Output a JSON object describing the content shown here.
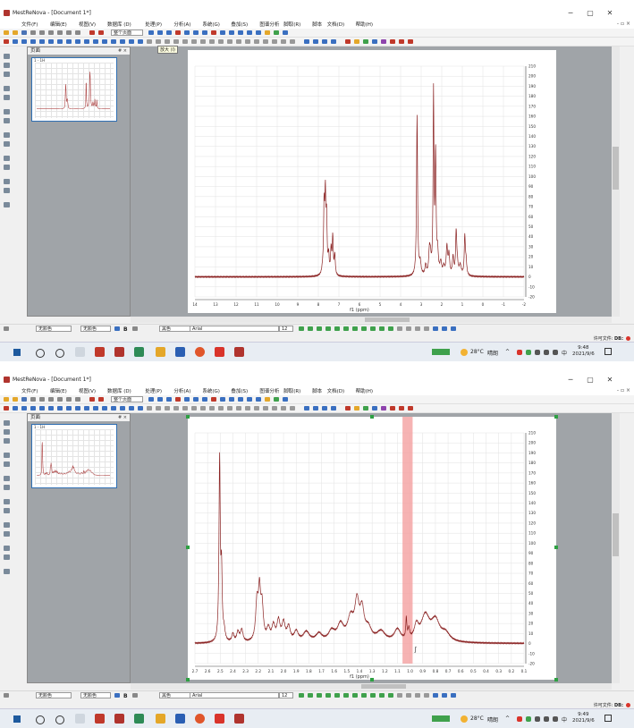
{
  "app": {
    "title": "MestReNova - [Document 1*]",
    "menu": [
      "文件(F)",
      "编辑(E)",
      "视图(V)",
      "数据库 (D)",
      "处理(P)",
      "分析(A)",
      "系统(G)",
      "叠加(S)",
      "图谱分析",
      "脚取(R)",
      "脚本",
      "文档(D)",
      "帮助(H)"
    ],
    "min_icon": "─",
    "max_icon": "▢",
    "close_icon": "✕",
    "mdi_buttons": "- ▫ ×"
  },
  "toolbar": {
    "zoom_combo": "整个页面",
    "tooltip": "放大 (I)"
  },
  "pages_panel": {
    "title": "页面",
    "close": "# ×",
    "thumb_label": "1 - 1H"
  },
  "bottom_toolbar": {
    "color_combo": "无颜色",
    "color_combo2": "无颜色",
    "bold": "B",
    "font_color": "黑色",
    "font_name": "Arial",
    "font_size": "12"
  },
  "status": {
    "license": "许可文件:",
    "db": "DB:"
  },
  "taskbar": {
    "temperature": "28°C",
    "weather": "晴朗",
    "ime": "中",
    "date": "2021/9/6"
  },
  "screenshots": [
    {
      "name": "full-spectrum",
      "clock_time": "9:48",
      "spectrum": {
        "xlabel": "f1 (ppm)",
        "xmin": -2,
        "xmax": 14,
        "xticks": [
          "14",
          "13",
          "12",
          "11",
          "10",
          "9",
          "8",
          "7",
          "6",
          "5",
          "4",
          "3",
          "2",
          "1",
          "0",
          "-1",
          "-2"
        ],
        "ymin": -20,
        "ymax": 210,
        "yticks": [
          "210",
          "200",
          "190",
          "180",
          "170",
          "160",
          "150",
          "140",
          "130",
          "120",
          "110",
          "100",
          "90",
          "80",
          "70",
          "60",
          "50",
          "40",
          "30",
          "20",
          "10",
          "0",
          "-10",
          "-20"
        ],
        "baseline": 0,
        "peaks": [
          [
            7.8,
            4,
            0.04
          ],
          [
            7.72,
            65,
            0.03
          ],
          [
            7.66,
            72,
            0.03
          ],
          [
            7.6,
            52,
            0.03
          ],
          [
            7.5,
            18,
            0.03
          ],
          [
            7.38,
            25,
            0.03
          ],
          [
            7.3,
            38,
            0.03
          ],
          [
            7.2,
            20,
            0.03
          ],
          [
            3.2,
            160,
            0.03
          ],
          [
            3.05,
            12,
            0.05
          ],
          [
            2.78,
            10,
            0.04
          ],
          [
            2.6,
            22,
            0.04
          ],
          [
            2.55,
            15,
            0.04
          ],
          [
            2.4,
            180,
            0.025
          ],
          [
            2.3,
            118,
            0.03
          ],
          [
            2.2,
            20,
            0.04
          ],
          [
            2.05,
            12,
            0.05
          ],
          [
            1.9,
            8,
            0.05
          ],
          [
            1.75,
            28,
            0.04
          ],
          [
            1.65,
            20,
            0.04
          ],
          [
            1.45,
            18,
            0.04
          ],
          [
            1.3,
            40,
            0.03
          ],
          [
            1.25,
            12,
            0.05
          ],
          [
            1.1,
            10,
            0.06
          ],
          [
            0.88,
            38,
            0.03
          ],
          [
            0.82,
            14,
            0.04
          ]
        ]
      }
    },
    {
      "name": "zoomed-spectrum",
      "clock_time": "9:49",
      "spectrum": {
        "xlabel": "f1 (ppm)",
        "xmin": 0.1,
        "xmax": 2.7,
        "xticks": [
          "2.7",
          "2.6",
          "2.5",
          "2.4",
          "2.3",
          "2.2",
          "2.1",
          "2.0",
          "1.9",
          "1.8",
          "1.7",
          "1.6",
          "1.5",
          "1.4",
          "1.3",
          "1.2",
          "1.1",
          "1.0",
          "0.9",
          "0.8",
          "0.7",
          "0.6",
          "0.5",
          "0.4",
          "0.3",
          "0.2",
          "0.1"
        ],
        "ymin": -20,
        "ymax": 210,
        "yticks": [
          "210",
          "200",
          "190",
          "180",
          "170",
          "160",
          "150",
          "140",
          "130",
          "120",
          "110",
          "100",
          "90",
          "80",
          "70",
          "60",
          "50",
          "40",
          "30",
          "20",
          "10",
          "0",
          "-10",
          "-20"
        ],
        "baseline": 0,
        "highlight": [
          0.98,
          1.06
        ],
        "integral_label": "ʃ",
        "peaks": [
          [
            2.505,
            180,
            0.006
          ],
          [
            2.49,
            65,
            0.006
          ],
          [
            2.47,
            10,
            0.01
          ],
          [
            2.4,
            8,
            0.01
          ],
          [
            2.36,
            10,
            0.012
          ],
          [
            2.33,
            12,
            0.012
          ],
          [
            2.21,
            38,
            0.012
          ],
          [
            2.19,
            45,
            0.01
          ],
          [
            2.17,
            34,
            0.012
          ],
          [
            2.12,
            12,
            0.015
          ],
          [
            2.08,
            15,
            0.015
          ],
          [
            2.04,
            20,
            0.015
          ],
          [
            2.0,
            18,
            0.015
          ],
          [
            1.96,
            14,
            0.015
          ],
          [
            1.9,
            10,
            0.02
          ],
          [
            1.82,
            10,
            0.03
          ],
          [
            1.72,
            8,
            0.03
          ],
          [
            1.62,
            10,
            0.03
          ],
          [
            1.55,
            16,
            0.03
          ],
          [
            1.47,
            22,
            0.03
          ],
          [
            1.42,
            35,
            0.02
          ],
          [
            1.38,
            28,
            0.02
          ],
          [
            1.33,
            12,
            0.03
          ],
          [
            1.23,
            10,
            0.04
          ],
          [
            1.1,
            12,
            0.03
          ],
          [
            1.03,
            20,
            0.005
          ],
          [
            1.01,
            10,
            0.008
          ],
          [
            0.95,
            14,
            0.02
          ],
          [
            0.88,
            25,
            0.04
          ],
          [
            0.8,
            20,
            0.04
          ],
          [
            0.72,
            8,
            0.04
          ]
        ]
      }
    }
  ]
}
